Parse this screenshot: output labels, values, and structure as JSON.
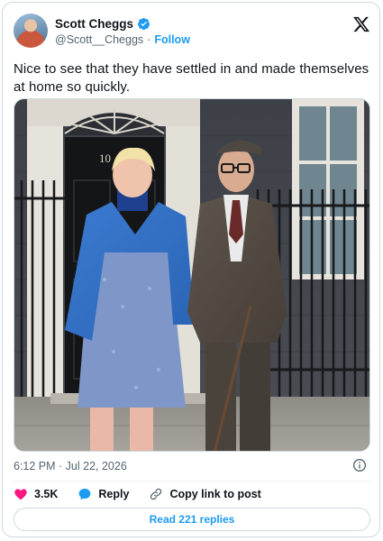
{
  "author": {
    "display_name": "Scott Cheggs",
    "handle": "@Scott__Cheggs",
    "separator": "·",
    "follow_label": "Follow",
    "verified": true
  },
  "tweet": {
    "text": "Nice to see that they have settled in and made themselves at home so quickly.",
    "timestamp": "6:12 PM · Jul 22, 2026"
  },
  "media": {
    "door_number": "10"
  },
  "actions": {
    "like_count": "3.5K",
    "reply_label": "Reply",
    "copy_link_label": "Copy link to post",
    "read_replies_label": "Read 221 replies"
  },
  "colors": {
    "accent": "#1d9bf0",
    "like": "#f91880",
    "text_secondary": "#536471"
  }
}
